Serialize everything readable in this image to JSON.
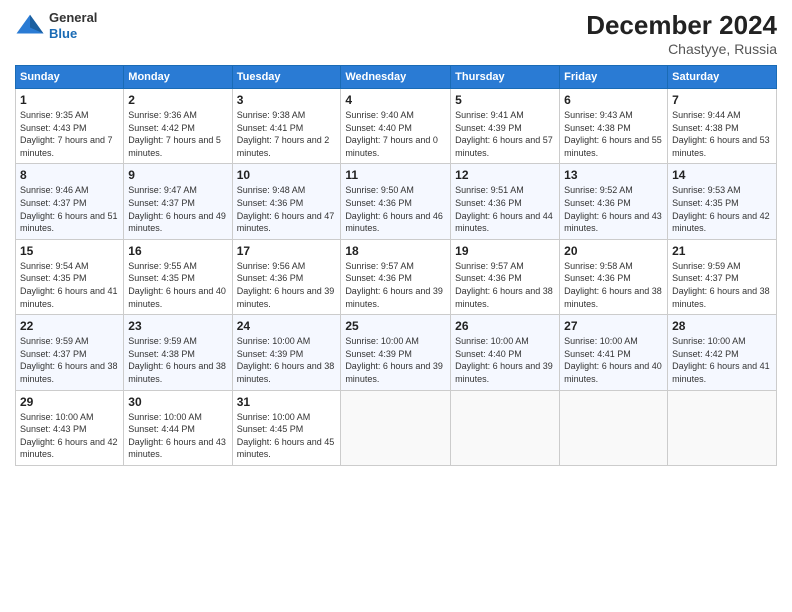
{
  "logo": {
    "line1": "General",
    "line2": "Blue"
  },
  "header": {
    "month_year": "December 2024",
    "location": "Chastyye, Russia"
  },
  "days_of_week": [
    "Sunday",
    "Monday",
    "Tuesday",
    "Wednesday",
    "Thursday",
    "Friday",
    "Saturday"
  ],
  "weeks": [
    [
      {
        "day": "1",
        "sunrise": "9:35 AM",
        "sunset": "4:43 PM",
        "daylight": "7 hours and 7 minutes."
      },
      {
        "day": "2",
        "sunrise": "9:36 AM",
        "sunset": "4:42 PM",
        "daylight": "7 hours and 5 minutes."
      },
      {
        "day": "3",
        "sunrise": "9:38 AM",
        "sunset": "4:41 PM",
        "daylight": "7 hours and 2 minutes."
      },
      {
        "day": "4",
        "sunrise": "9:40 AM",
        "sunset": "4:40 PM",
        "daylight": "7 hours and 0 minutes."
      },
      {
        "day": "5",
        "sunrise": "9:41 AM",
        "sunset": "4:39 PM",
        "daylight": "6 hours and 57 minutes."
      },
      {
        "day": "6",
        "sunrise": "9:43 AM",
        "sunset": "4:38 PM",
        "daylight": "6 hours and 55 minutes."
      },
      {
        "day": "7",
        "sunrise": "9:44 AM",
        "sunset": "4:38 PM",
        "daylight": "6 hours and 53 minutes."
      }
    ],
    [
      {
        "day": "8",
        "sunrise": "9:46 AM",
        "sunset": "4:37 PM",
        "daylight": "6 hours and 51 minutes."
      },
      {
        "day": "9",
        "sunrise": "9:47 AM",
        "sunset": "4:37 PM",
        "daylight": "6 hours and 49 minutes."
      },
      {
        "day": "10",
        "sunrise": "9:48 AM",
        "sunset": "4:36 PM",
        "daylight": "6 hours and 47 minutes."
      },
      {
        "day": "11",
        "sunrise": "9:50 AM",
        "sunset": "4:36 PM",
        "daylight": "6 hours and 46 minutes."
      },
      {
        "day": "12",
        "sunrise": "9:51 AM",
        "sunset": "4:36 PM",
        "daylight": "6 hours and 44 minutes."
      },
      {
        "day": "13",
        "sunrise": "9:52 AM",
        "sunset": "4:36 PM",
        "daylight": "6 hours and 43 minutes."
      },
      {
        "day": "14",
        "sunrise": "9:53 AM",
        "sunset": "4:35 PM",
        "daylight": "6 hours and 42 minutes."
      }
    ],
    [
      {
        "day": "15",
        "sunrise": "9:54 AM",
        "sunset": "4:35 PM",
        "daylight": "6 hours and 41 minutes."
      },
      {
        "day": "16",
        "sunrise": "9:55 AM",
        "sunset": "4:35 PM",
        "daylight": "6 hours and 40 minutes."
      },
      {
        "day": "17",
        "sunrise": "9:56 AM",
        "sunset": "4:36 PM",
        "daylight": "6 hours and 39 minutes."
      },
      {
        "day": "18",
        "sunrise": "9:57 AM",
        "sunset": "4:36 PM",
        "daylight": "6 hours and 39 minutes."
      },
      {
        "day": "19",
        "sunrise": "9:57 AM",
        "sunset": "4:36 PM",
        "daylight": "6 hours and 38 minutes."
      },
      {
        "day": "20",
        "sunrise": "9:58 AM",
        "sunset": "4:36 PM",
        "daylight": "6 hours and 38 minutes."
      },
      {
        "day": "21",
        "sunrise": "9:59 AM",
        "sunset": "4:37 PM",
        "daylight": "6 hours and 38 minutes."
      }
    ],
    [
      {
        "day": "22",
        "sunrise": "9:59 AM",
        "sunset": "4:37 PM",
        "daylight": "6 hours and 38 minutes."
      },
      {
        "day": "23",
        "sunrise": "9:59 AM",
        "sunset": "4:38 PM",
        "daylight": "6 hours and 38 minutes."
      },
      {
        "day": "24",
        "sunrise": "10:00 AM",
        "sunset": "4:39 PM",
        "daylight": "6 hours and 38 minutes."
      },
      {
        "day": "25",
        "sunrise": "10:00 AM",
        "sunset": "4:39 PM",
        "daylight": "6 hours and 39 minutes."
      },
      {
        "day": "26",
        "sunrise": "10:00 AM",
        "sunset": "4:40 PM",
        "daylight": "6 hours and 39 minutes."
      },
      {
        "day": "27",
        "sunrise": "10:00 AM",
        "sunset": "4:41 PM",
        "daylight": "6 hours and 40 minutes."
      },
      {
        "day": "28",
        "sunrise": "10:00 AM",
        "sunset": "4:42 PM",
        "daylight": "6 hours and 41 minutes."
      }
    ],
    [
      {
        "day": "29",
        "sunrise": "10:00 AM",
        "sunset": "4:43 PM",
        "daylight": "6 hours and 42 minutes."
      },
      {
        "day": "30",
        "sunrise": "10:00 AM",
        "sunset": "4:44 PM",
        "daylight": "6 hours and 43 minutes."
      },
      {
        "day": "31",
        "sunrise": "10:00 AM",
        "sunset": "4:45 PM",
        "daylight": "6 hours and 45 minutes."
      },
      null,
      null,
      null,
      null
    ]
  ],
  "labels": {
    "sunrise": "Sunrise: ",
    "sunset": "Sunset: ",
    "daylight": "Daylight: "
  }
}
